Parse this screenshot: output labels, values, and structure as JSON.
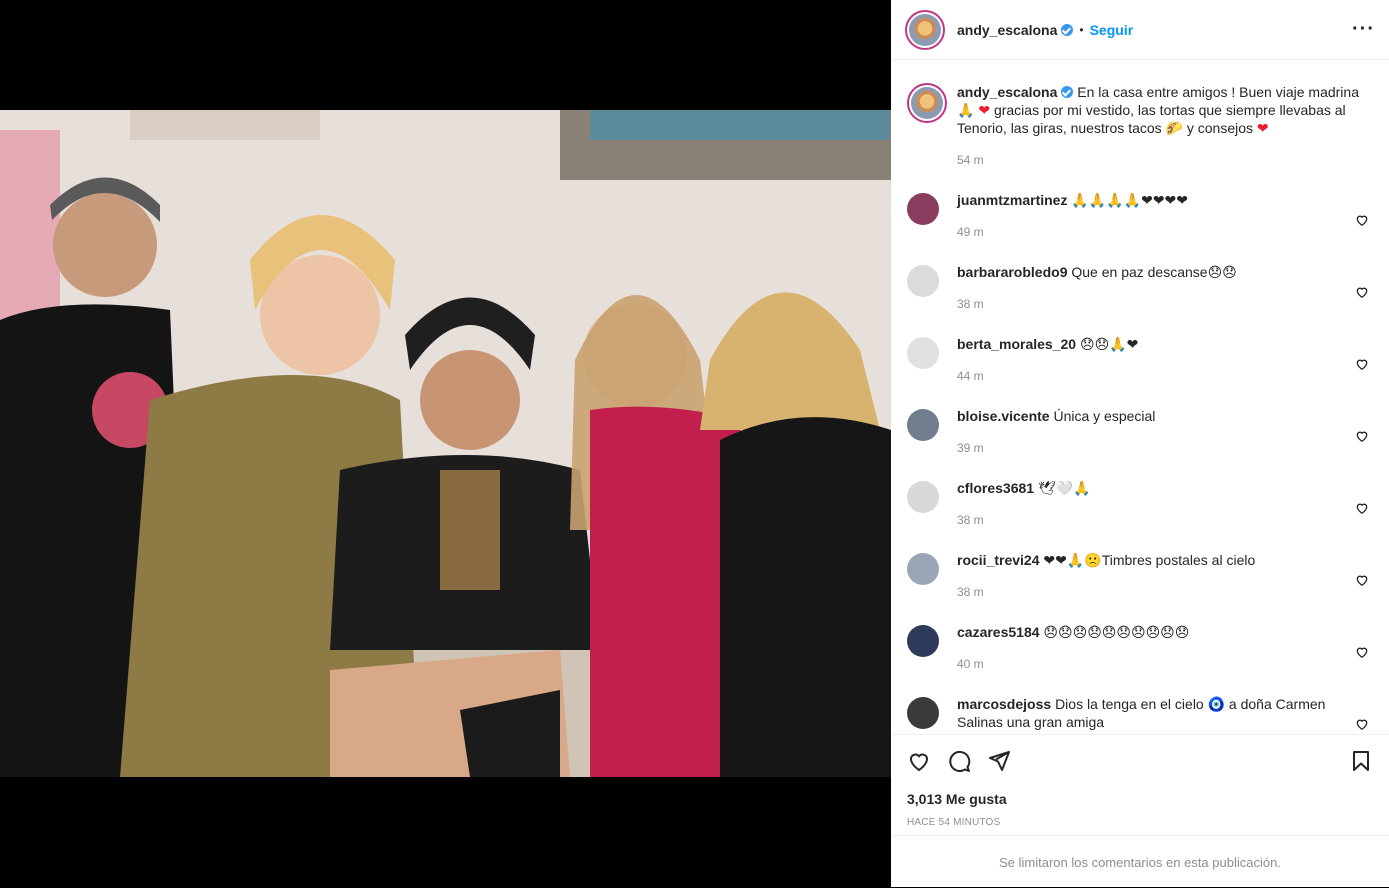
{
  "colors": {
    "accent": "#0095f6",
    "verified": "#3897f0",
    "muted": "#8e8e8e",
    "heart": "#ed1c2e"
  },
  "header": {
    "username": "andy_escalona",
    "separator": "•",
    "follow_label": "Seguir",
    "more_icon": "more-horizontal-icon"
  },
  "caption": {
    "username": "andy_escalona",
    "text_1": "En la casa entre amigos ! Buen viaje madrina ",
    "text_2": " gracias por mi vestido, las tortas que siempre llevabas al Tenorio, las giras, nuestros tacos ",
    "text_3": " y consejos ",
    "emoji_pray": "🙏",
    "emoji_heart": "❤",
    "emoji_taco": "🌮",
    "time": "54 m"
  },
  "comments": [
    {
      "username": "juanmtzmartinez",
      "text": "🙏🙏🙏🙏❤❤❤❤",
      "time": "49 m"
    },
    {
      "username": "barbararobledo9",
      "text": "Que en paz descanse😞😞",
      "time": "38 m"
    },
    {
      "username": "berta_morales_20",
      "text": "😞😞🙏❤",
      "time": "44 m"
    },
    {
      "username": "bloise.vicente",
      "text": "Única y especial",
      "time": "39 m"
    },
    {
      "username": "cflores3681",
      "text": "🕊🤍🙏",
      "time": "38 m"
    },
    {
      "username": "rocii_trevi24",
      "text": "❤❤🙏🙁Timbres postales al cielo",
      "time": "38 m"
    },
    {
      "username": "cazares5184",
      "text": "😞😞😞😞😞😞😞😞😞😞",
      "time": "40 m"
    },
    {
      "username": "marcosdejoss",
      "text": "Dios la tenga en el cielo 🧿 a doña Carmen Salinas una gran amiga",
      "time": ""
    }
  ],
  "actions": {
    "like_icon": "heart-icon",
    "comment_icon": "comment-icon",
    "share_icon": "share-icon",
    "save_icon": "bookmark-icon",
    "likes": "3,013 Me gusta",
    "posted_ago": "HACE 54 MINUTOS",
    "limited_comments": "Se limitaron los comentarios en esta publicación."
  }
}
